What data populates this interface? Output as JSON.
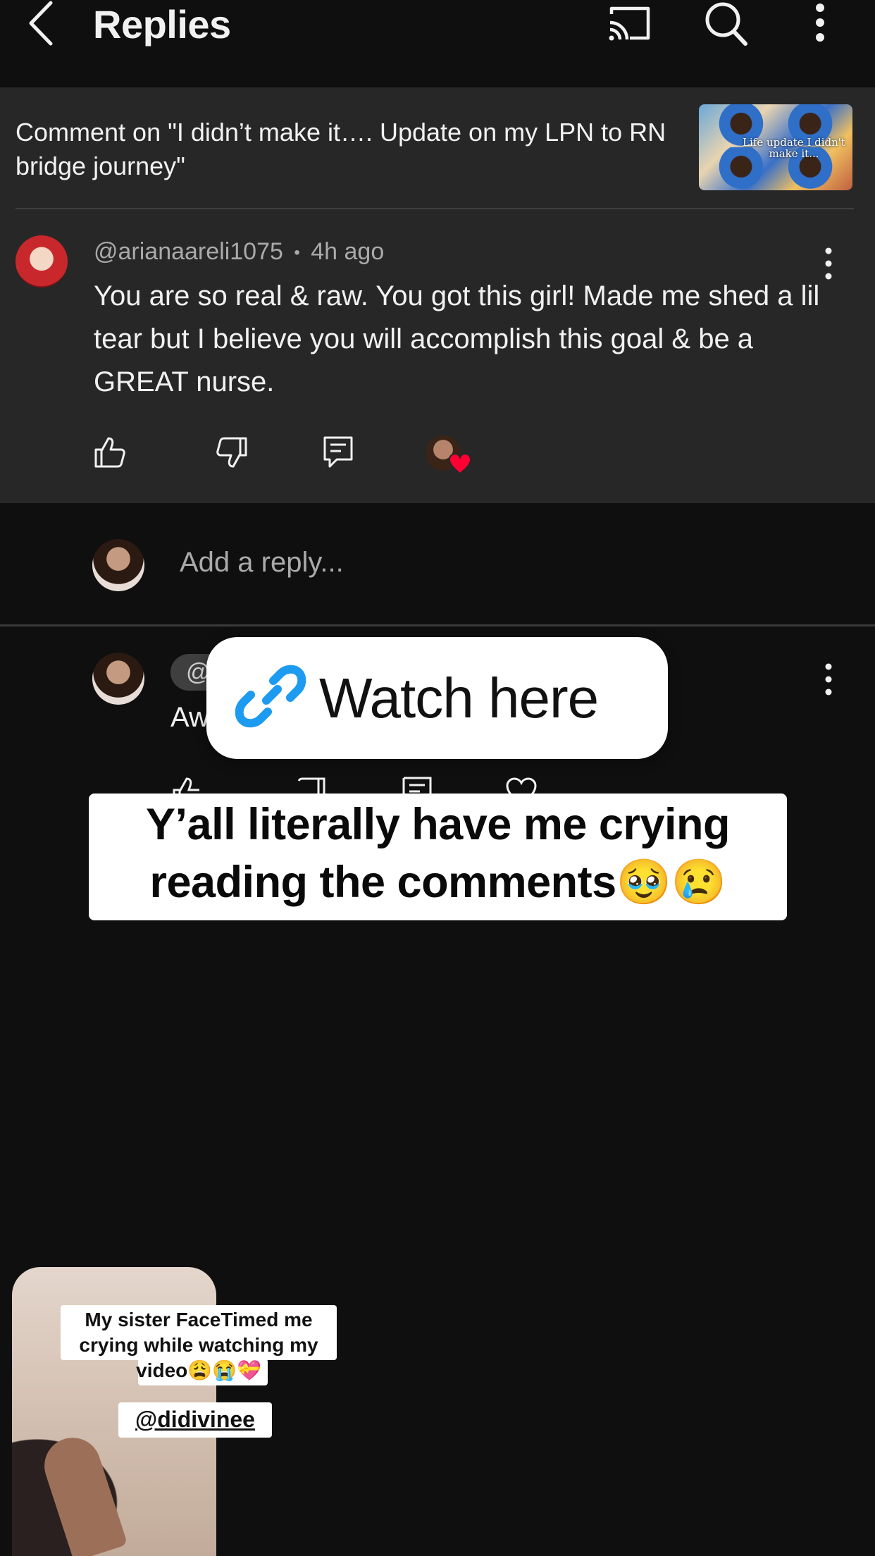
{
  "header": {
    "title": "Replies"
  },
  "comment": {
    "context": "Comment on \"I didn’t make it…. Update on my LPN to RN bridge journey\"",
    "thumbnail_caption": "Life update \n I didn't make it...",
    "author": "@arianaareli1075",
    "time": "4h ago",
    "separator": "•",
    "text": "You are so real & raw. You got this girl! Made me shed a lil tear but I believe you will accomplish this goal & be a GREAT nurse."
  },
  "reply_box": {
    "placeholder": "Add a reply..."
  },
  "reply": {
    "handle_prefix": "@",
    "text_fragment": "Aw"
  },
  "overlays": {
    "watch_label": "Watch here",
    "caption_line1": "Y’all literally have me crying",
    "caption_line2": "reading the comments🥹😢",
    "pip_caption": "My sister FaceTimed me crying while watching my video😩😭💝",
    "pip_tag": "@didivinee"
  },
  "colors": {
    "background": "#0f0f0f",
    "card": "#272727",
    "link_blue": "#1d9bf0",
    "heart_red": "#ff0033"
  },
  "icons": [
    "back-icon",
    "cast-icon",
    "search-icon",
    "more-vert-icon",
    "like-icon",
    "dislike-icon",
    "reply-icon",
    "heart-icon",
    "link-icon"
  ]
}
